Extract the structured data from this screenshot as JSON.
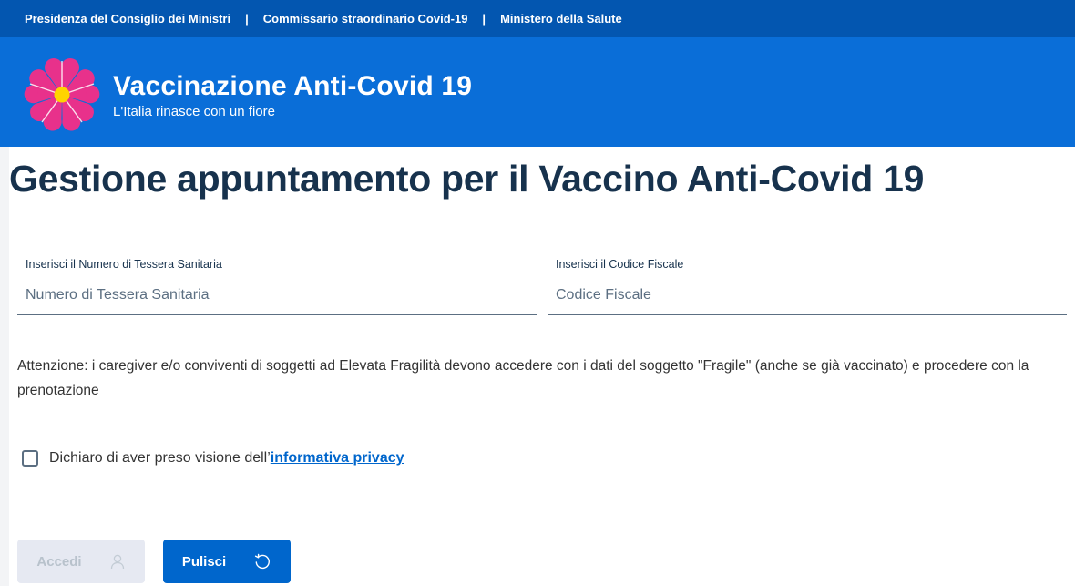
{
  "topbar": {
    "links": [
      "Presidenza del Consiglio dei Ministri",
      "Commissario straordinario Covid-19",
      "Ministero della Salute"
    ],
    "separator": "|"
  },
  "header": {
    "title": "Vaccinazione Anti-Covid 19",
    "subtitle": "L'Italia rinasce con un fiore",
    "logo_icon": "primula-flower-icon",
    "colors": {
      "topbar": "#0356b0",
      "header": "#0a6ed8",
      "flower": "#e8318b",
      "flower_center": "#ffd400"
    }
  },
  "main": {
    "title": "Gestione appuntamento per il Vaccino Anti-Covid 19",
    "fields": [
      {
        "label": "Inserisci il Numero di Tessera Sanitaria",
        "placeholder": "Numero di Tessera Sanitaria",
        "value": ""
      },
      {
        "label": "Inserisci il Codice Fiscale",
        "placeholder": "Codice Fiscale",
        "value": ""
      }
    ],
    "notice": "Attenzione: i caregiver e/o conviventi di soggetti ad Elevata Fragilità devono accedere con i dati del soggetto \"Fragile\" (anche se già vaccinato) e procedere con la prenotazione",
    "consent": {
      "text": "Dichiaro di aver preso visione dell’",
      "link": "informativa privacy",
      "checked": false
    },
    "buttons": {
      "accedi": {
        "label": "Accedi",
        "icon": "user-icon",
        "disabled": true
      },
      "pulisci": {
        "label": "Pulisci",
        "icon": "reset-icon"
      }
    }
  }
}
